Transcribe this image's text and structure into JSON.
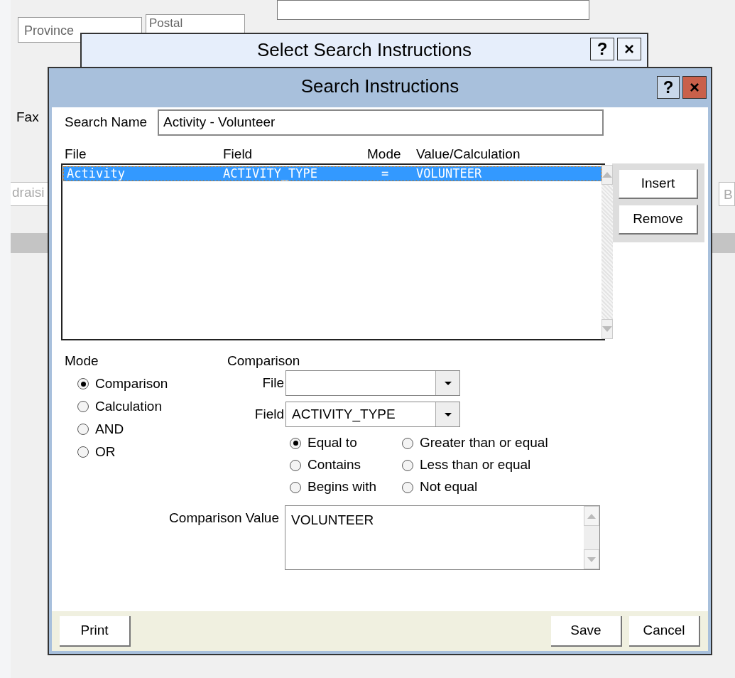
{
  "background_window": {
    "province_field": {
      "value": "Province"
    },
    "postal_field": {
      "value": "Postal"
    },
    "fax_label": "Fax",
    "left_tab": "draisi",
    "right_tab": "B"
  },
  "back_dialog": {
    "title": "Select Search Instructions",
    "help": "?",
    "close": "×"
  },
  "dialog": {
    "title": "Search Instructions",
    "help": "?",
    "close": "×",
    "search_name": {
      "label": "Search Name",
      "value": "Activity - Volunteer"
    },
    "list": {
      "columns": [
        "File",
        "Field",
        "Mode",
        "Value/Calculation"
      ],
      "rows": [
        {
          "cells": [
            "Activity",
            "ACTIVITY_TYPE",
            "=",
            "VOLUNTEER"
          ],
          "selected": true
        }
      ]
    },
    "side_buttons": [
      "Insert",
      "Remove"
    ],
    "mode": {
      "label": "Mode",
      "options": [
        {
          "label": "Comparison",
          "selected": true
        },
        {
          "label": "Calculation",
          "selected": false
        },
        {
          "label": "AND",
          "selected": false
        },
        {
          "label": "OR",
          "selected": false
        }
      ]
    },
    "comparison": {
      "label": "Comparison",
      "file": {
        "label": "File"
      },
      "field": {
        "label": "Field",
        "value": "ACTIVITY_TYPE"
      },
      "operators": [
        {
          "label": "Equal to",
          "selected": true
        },
        {
          "label": "Contains",
          "selected": false
        },
        {
          "label": "Begins with",
          "selected": false
        },
        {
          "label": "Greater than or equal",
          "selected": false
        },
        {
          "label": "Less than or equal",
          "selected": false
        },
        {
          "label": "Not equal",
          "selected": false
        }
      ],
      "value": {
        "label": "Comparison Value",
        "value": "VOLUNTEER"
      }
    },
    "footer": {
      "left_buttons": [
        "Print"
      ],
      "right_buttons": [
        "Save",
        "Cancel"
      ]
    }
  }
}
